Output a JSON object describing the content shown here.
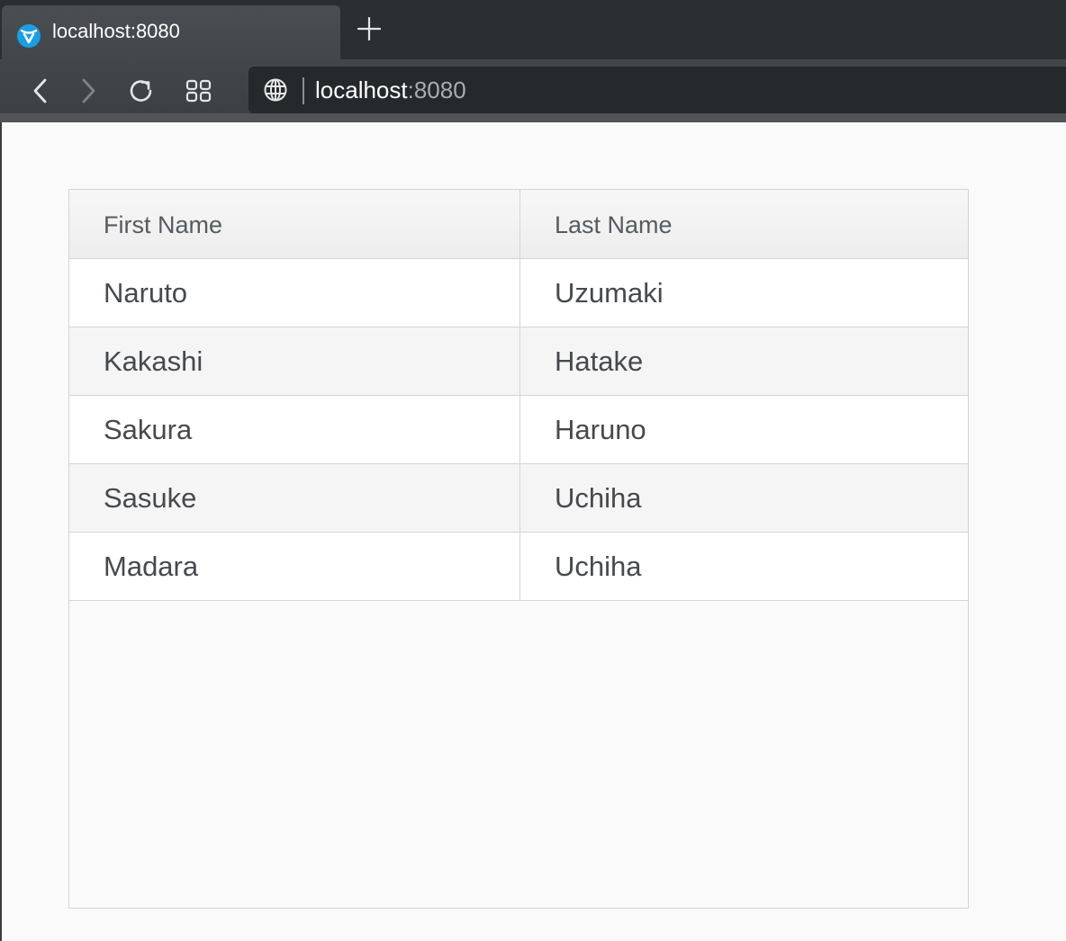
{
  "browser": {
    "tab_title": "localhost:8080",
    "address_host": "localhost",
    "address_port": ":8080"
  },
  "grid": {
    "columns": [
      "First Name",
      "Last Name"
    ],
    "rows": [
      {
        "first": "Naruto",
        "last": "Uzumaki"
      },
      {
        "first": "Kakashi",
        "last": "Hatake"
      },
      {
        "first": "Sakura",
        "last": "Haruno"
      },
      {
        "first": "Sasuke",
        "last": "Uchiha"
      },
      {
        "first": "Madara",
        "last": "Uchiha"
      }
    ]
  },
  "colors": {
    "favicon": "#1a9fe4",
    "chrome_dark": "#2f3336",
    "address_bg": "#25292b",
    "grid_border": "#d4d4d4",
    "row_stripe": "#f5f5f5"
  },
  "icons": {
    "favicon": "vaadin-logo-icon",
    "new_tab": "plus-icon",
    "back": "chevron-left-icon",
    "forward": "chevron-right-icon",
    "reload": "reload-icon",
    "speed_dial": "grid-icon",
    "site_info": "globe-icon"
  }
}
